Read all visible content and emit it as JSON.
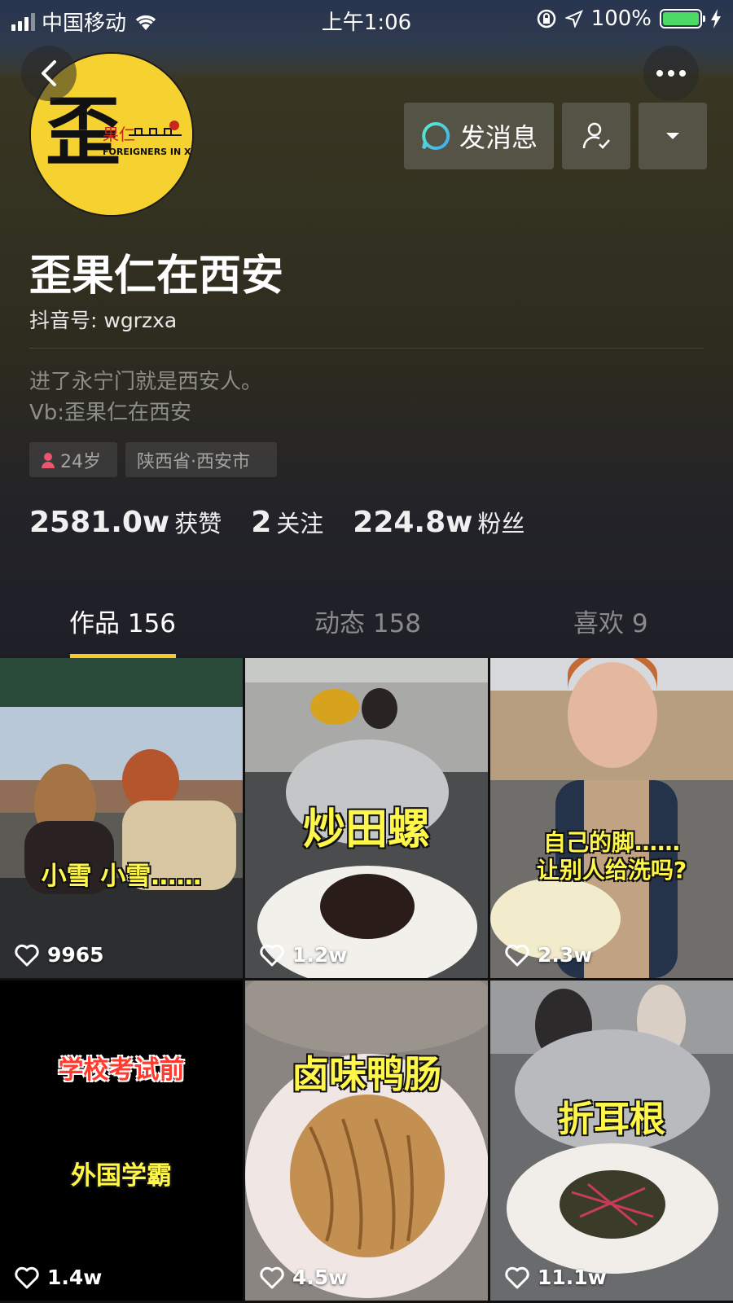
{
  "status_bar": {
    "carrier": "中国移动",
    "time": "上午1:06",
    "battery": "100%"
  },
  "profile": {
    "avatar_logo_text": "歪",
    "avatar_logo_small": "果仁",
    "avatar_logo_sub": "FOREIGNERS IN XI'AN",
    "name": "歪果仁在西安",
    "douyin_id": "抖音号: wgrzxa",
    "bio_line1": "进了永宁门就是西安人。",
    "bio_line2": "Vb:歪果仁在西安",
    "age_tag": "24岁",
    "location_tag": "陕西省·西安市"
  },
  "actions": {
    "message_label": "发消息"
  },
  "stats": [
    {
      "value": "2581.0w",
      "label": "获赞"
    },
    {
      "value": "2",
      "label": "关注"
    },
    {
      "value": "224.8w",
      "label": "粉丝"
    }
  ],
  "tabs": [
    {
      "label": "作品 156",
      "active": true
    },
    {
      "label": "动态 158",
      "active": false
    },
    {
      "label": "喜欢 9",
      "active": false
    }
  ],
  "videos": [
    {
      "caption": "小雪 小雪……",
      "likes": "9965"
    },
    {
      "caption": "炒田螺",
      "likes": "1.2w"
    },
    {
      "caption_line1": "自己的脚……",
      "caption_line2": "让别人给洗吗?",
      "likes": "2.3w"
    },
    {
      "caption_line1": "学校考试前",
      "caption_line2": "外国学霸",
      "likes": "1.4w"
    },
    {
      "caption": "卤味鸭肠",
      "likes": "4.5w"
    },
    {
      "caption": "折耳根",
      "likes": "11.1w"
    }
  ],
  "colors": {
    "accent": "#f6c928",
    "battery": "#4cd964",
    "caption_yellow": "#fff64a",
    "caption_red": "#ff3b30"
  },
  "icons": [
    "back-icon",
    "more-icon",
    "message-bubble-icon",
    "follow-user-icon",
    "dropdown-icon",
    "heart-icon",
    "wifi-icon",
    "location-arrow-icon",
    "lock-rotation-icon",
    "charging-icon"
  ]
}
